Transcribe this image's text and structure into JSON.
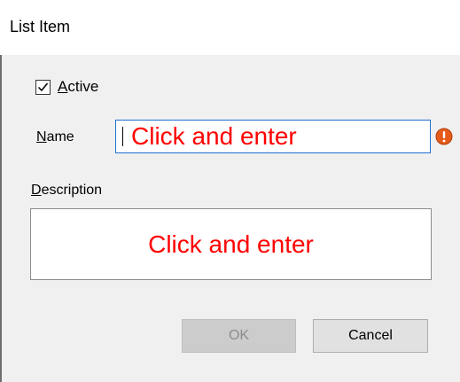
{
  "window": {
    "title": "List Item"
  },
  "form": {
    "active": {
      "label_accel": "A",
      "label_rest": "ctive",
      "checked": true
    },
    "name": {
      "label_accel": "N",
      "label_rest": "ame",
      "value": "Click and enter",
      "error_icon": "error-exclamation-icon"
    },
    "description": {
      "label_accel": "D",
      "label_rest": "escription",
      "value": "Click and enter"
    }
  },
  "buttons": {
    "ok_label": "OK",
    "cancel_label": "Cancel"
  },
  "colors": {
    "hint_text": "#ff0000",
    "focus_border": "#1f6fd0",
    "error_icon": "#e55b1a"
  }
}
